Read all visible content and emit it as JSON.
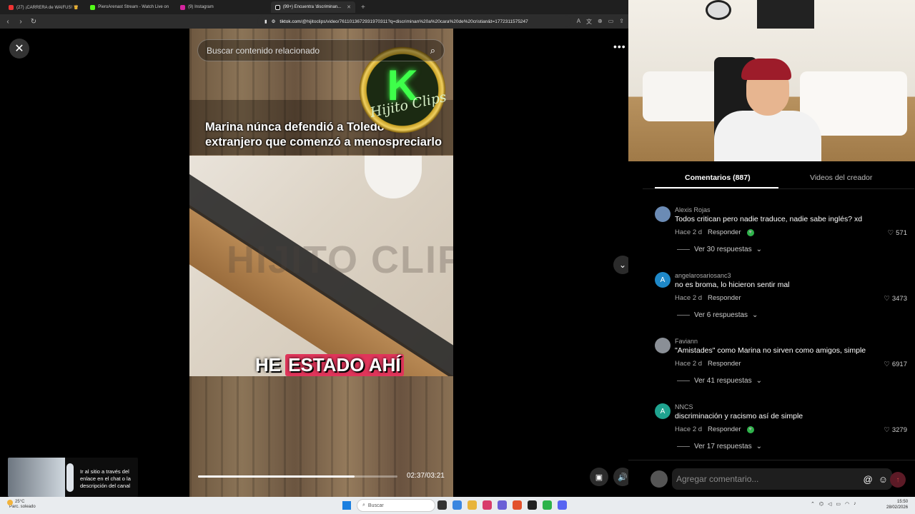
{
  "browser": {
    "tabs": [
      {
        "label": "(27) ¡CARRERA de WAIFUS! 👸",
        "color": "#e33"
      },
      {
        "label": "PieroArenast Stream - Watch Live on",
        "color": "#53fc18"
      },
      {
        "label": "(9) Instagram",
        "color": "#d6249f"
      },
      {
        "label": "(99+) Encuentra 'discriminan...",
        "color": "#111"
      }
    ],
    "url_site": "tiktok.com",
    "url_path": "/@hijitoclips/video/7611013672931970311?q=discriminan%20a%20cara%20de%20cristian&t=1772311575247"
  },
  "video": {
    "search_placeholder": "Buscar contenido relacionado",
    "headline": "Marina núnca defendió a Toledo de extranjero que comenzó a menospreciarlo",
    "watermark": "HIJITO CLIPS",
    "logo_letter": "K",
    "logo_text": "Hijito Clips",
    "caption_word1": "HE",
    "caption_word2": "ESTADO AHÍ",
    "progress": 0.785,
    "time": "02:37/03:21"
  },
  "notification": {
    "text": "Ir al sitio a través del enlace en el chat o la descripción del canal"
  },
  "panel": {
    "tab_comments": "Comentarios (887)",
    "tab_creator": "Videos del creador",
    "comments": [
      {
        "user": "Alexis Rojas",
        "text": "Todos critican pero nadie traduce, nadie sabe inglés? xd",
        "time": "Hace 2 d",
        "reply": "Responder",
        "likes": "571",
        "replies": "Ver 30 respuestas",
        "avatar": "",
        "avatar_color": "#6b8bb5",
        "react": true
      },
      {
        "user": "angelarosariosanc3",
        "text": "no es broma, lo hicieron sentir mal",
        "time": "Hace 2 d",
        "reply": "Responder",
        "likes": "3473",
        "replies": "Ver 6 respuestas",
        "avatar": "A",
        "avatar_color": "#1e88c8",
        "react": false
      },
      {
        "user": "Faviann",
        "text": "\"Amistades\" como Marina no sirven como amigos, simple",
        "time": "Hace 2 d",
        "reply": "Responder",
        "likes": "6917",
        "replies": "Ver 41 respuestas",
        "avatar": "",
        "avatar_color": "#8a8f96",
        "react": false
      },
      {
        "user": "NNCS",
        "text": "discriminación y racismo así de simple",
        "time": "Hace 2 d",
        "reply": "Responder",
        "likes": "3279",
        "replies": "Ver 17 respuestas",
        "avatar": "A",
        "avatar_color": "#1fa38f",
        "react": true
      }
    ],
    "add_placeholder": "Agregar comentario..."
  },
  "taskbar": {
    "temp": "25°C",
    "weather": "Parc. soleado",
    "search": "Buscar",
    "time": "15:50",
    "date": "28/02/2026"
  }
}
